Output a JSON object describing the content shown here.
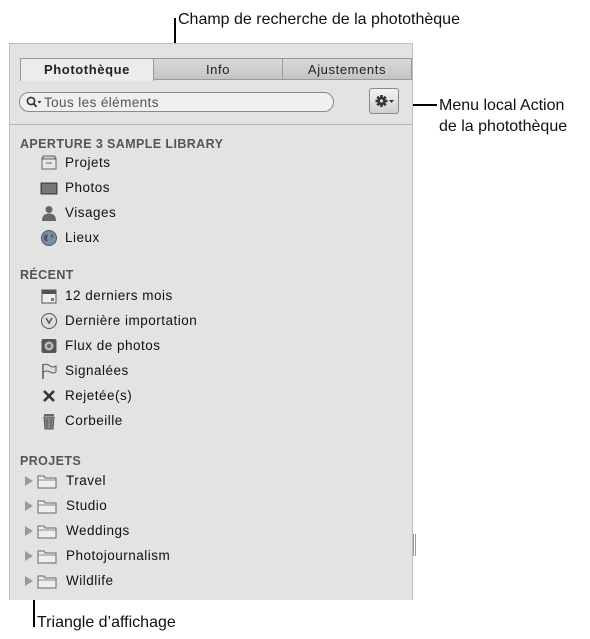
{
  "callouts": {
    "search_field": "Champ de recherche de la photothèque",
    "action_menu_line1": "Menu local Action",
    "action_menu_line2": "de la photothèque",
    "disclosure_triangle": "Triangle d’affichage"
  },
  "tabs": [
    {
      "label": "Photothèque",
      "active": true
    },
    {
      "label": "Info",
      "active": false
    },
    {
      "label": "Ajustements",
      "active": false
    }
  ],
  "search": {
    "placeholder": "Tous les éléments"
  },
  "library": {
    "title": "APERTURE 3 SAMPLE LIBRARY",
    "items": [
      {
        "label": "Projets",
        "icon": "projects-icon"
      },
      {
        "label": "Photos",
        "icon": "photos-icon"
      },
      {
        "label": "Visages",
        "icon": "faces-icon"
      },
      {
        "label": "Lieux",
        "icon": "globe-icon"
      }
    ]
  },
  "recent": {
    "title": "RÉCENT",
    "items": [
      {
        "label": "12 derniers mois",
        "icon": "calendar-icon"
      },
      {
        "label": "Dernière importation",
        "icon": "import-icon"
      },
      {
        "label": "Flux de photos",
        "icon": "photostream-icon"
      },
      {
        "label": "Signalées",
        "icon": "flag-icon"
      },
      {
        "label": "Rejetée(s)",
        "icon": "reject-x-icon"
      },
      {
        "label": "Corbeille",
        "icon": "trash-icon"
      }
    ]
  },
  "projects": {
    "title": "PROJETS",
    "items": [
      {
        "label": "Travel"
      },
      {
        "label": "Studio"
      },
      {
        "label": "Weddings"
      },
      {
        "label": "Photojournalism"
      },
      {
        "label": "Wildlife"
      }
    ]
  }
}
